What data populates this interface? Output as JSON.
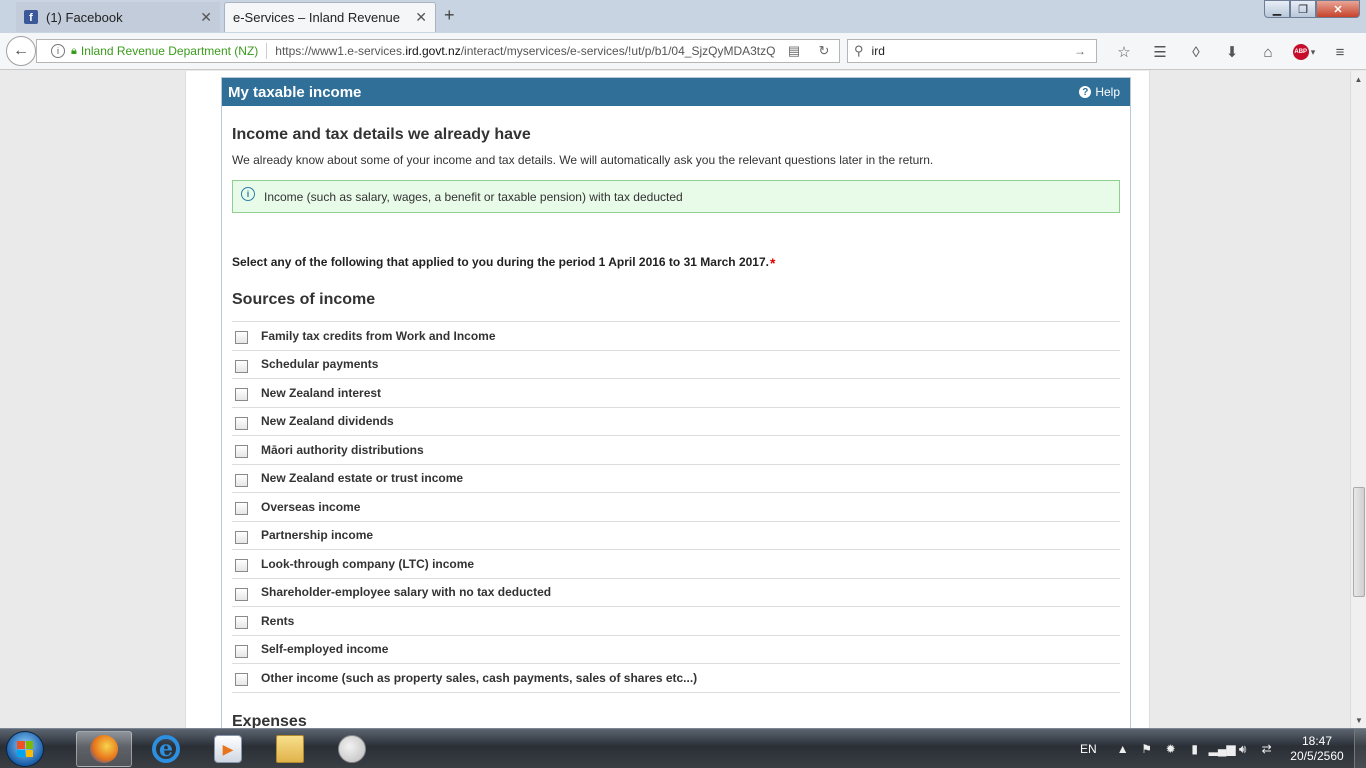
{
  "browser": {
    "tabs": [
      {
        "title": "(1) Facebook",
        "favicon": "facebook-icon",
        "active": false
      },
      {
        "title": "e-Services – Inland Revenue",
        "favicon": "ird-icon",
        "active": true
      }
    ],
    "new_tab": "+",
    "identity": "Inland Revenue Department (NZ)",
    "url_prefix": "https://www1.e-services.",
    "url_domain": "ird.govt.nz",
    "url_rest": "/interact/myservices/e-services/!ut/p/b1/04_SjzQyMDA3tzQ",
    "search_value": "ird"
  },
  "panel": {
    "title": "My taxable income",
    "help_label": "Help",
    "section_title": "Income and tax details we already have",
    "section_desc": "We already know about some of your income and tax details. We will automatically ask you the relevant questions later in the return.",
    "info_text": "Income (such as salary, wages, a benefit or taxable pension) with tax deducted",
    "question": "Select any of the following that applied to you during the period 1 April 2016 to 31 March 2017.",
    "required_mark": "*",
    "sources_title": "Sources of income",
    "sources": [
      "Family tax credits from Work and Income",
      "Schedular payments",
      "New Zealand interest",
      "New Zealand dividends",
      "Māori authority distributions",
      "New Zealand estate or trust income",
      "Overseas income",
      "Partnership income",
      "Look-through company (LTC) income",
      "Shareholder-employee salary with no tax deducted",
      "Rents",
      "Self-employed income",
      "Other income (such as property sales, cash payments, sales of shares etc...)"
    ],
    "expenses_title": "Expenses"
  },
  "taskbar": {
    "language": "EN",
    "time": "18:47",
    "date": "20/5/2560"
  },
  "colors": {
    "panel_header": "#2f6f98",
    "info_background": "#e8fae8",
    "secure_green": "#3a9b1b",
    "required": "#dd0000"
  }
}
